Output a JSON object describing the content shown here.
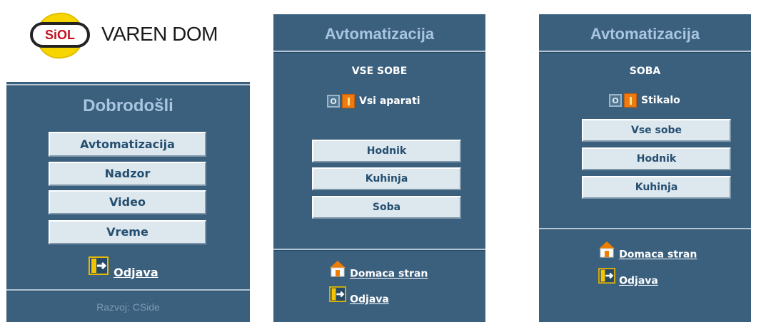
{
  "logo": {
    "badge_text": "SiOL",
    "name": "VAREN DOM"
  },
  "panel1": {
    "title": "Dobrodošli",
    "menu": [
      "Avtomatizacija",
      "Nadzor",
      "Video",
      "Vreme"
    ],
    "logout_label": "Odjava",
    "footer": "Razvoj: CSide"
  },
  "panel2": {
    "title": "Avtomatizacija",
    "section": "VSE SOBE",
    "toggle": {
      "off_label": "O",
      "label": "Vsi aparati"
    },
    "rooms": [
      "Hodnik",
      "Kuhinja",
      "Soba"
    ],
    "home_label": "Domaca stran",
    "logout_label": "Odjava"
  },
  "panel3": {
    "title": "Avtomatizacija",
    "section": "SOBA",
    "toggle": {
      "off_label": "O",
      "label": "Stikalo"
    },
    "rooms": [
      "Vse sobe",
      "Hodnik",
      "Kuhinja"
    ],
    "home_label": "Domaca stran",
    "logout_label": "Odjava"
  },
  "colors": {
    "panel_bg": "#3b607e",
    "title_text": "#a9c5e0",
    "button_bg": "#dde7ee",
    "button_text": "#254f70",
    "toggle_on": "#ef7a12",
    "logo_yellow": "#f7d500"
  },
  "icons": {
    "logout": "logout-door-icon",
    "home": "home-house-icon",
    "logo": "siol-badge-icon"
  }
}
